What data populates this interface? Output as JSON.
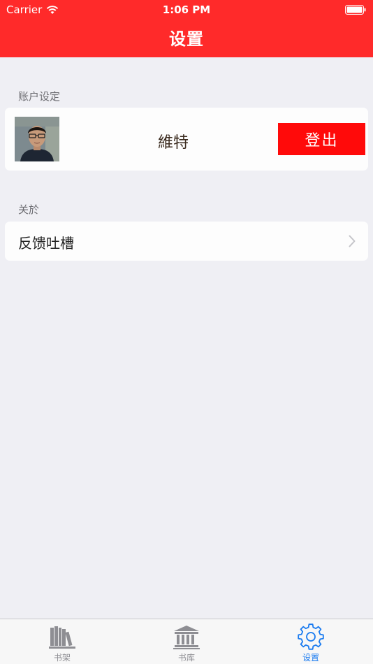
{
  "status_bar": {
    "carrier": "Carrier",
    "time": "1:06 PM"
  },
  "nav": {
    "title": "设置"
  },
  "account_section": {
    "header": "账户设定",
    "username": "維特",
    "logout_label": "登出"
  },
  "about_section": {
    "header": "关於",
    "feedback_label": "反馈吐槽"
  },
  "tabs": [
    {
      "label": "书架",
      "icon": "bookshelf-icon",
      "active": false
    },
    {
      "label": "书库",
      "icon": "library-icon",
      "active": false
    },
    {
      "label": "设置",
      "icon": "gear-icon",
      "active": true
    }
  ],
  "colors": {
    "header_red": "#ff2a2a",
    "logout_red": "#ff0a0a",
    "tab_active_blue": "#1a7bf0",
    "tab_inactive_gray": "#8e8e93",
    "background": "#efeff4"
  }
}
